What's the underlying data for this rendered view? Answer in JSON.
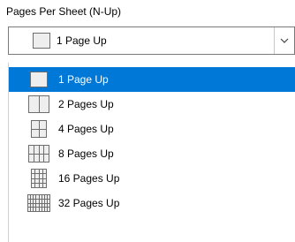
{
  "dialog": {
    "field_label": "Pages Per Sheet (N-Up)",
    "combo": {
      "value": "1 Page Up",
      "icon": "1-up-page-icon",
      "arrow_icon": "chevron-down-icon"
    },
    "options": [
      {
        "label": "1 Page Up",
        "icon": "1-up-page-icon",
        "cols": 1,
        "rows": 1,
        "selected": true
      },
      {
        "label": "2 Pages Up",
        "icon": "2-up-page-icon",
        "cols": 2,
        "rows": 1,
        "selected": false
      },
      {
        "label": "4 Pages Up",
        "icon": "4-up-page-icon",
        "cols": 2,
        "rows": 2,
        "selected": false
      },
      {
        "label": "8 Pages Up",
        "icon": "8-up-page-icon",
        "cols": 4,
        "rows": 2,
        "selected": false
      },
      {
        "label": "16 Pages Up",
        "icon": "16-up-page-icon",
        "cols": 4,
        "rows": 4,
        "selected": false
      },
      {
        "label": "32 Pages Up",
        "icon": "32-up-page-icon",
        "cols": 8,
        "rows": 4,
        "selected": false
      }
    ],
    "colors": {
      "selection": "#0078d7",
      "icon_stroke": "#6e6e6e",
      "icon_fill": "#eeeeee"
    }
  }
}
